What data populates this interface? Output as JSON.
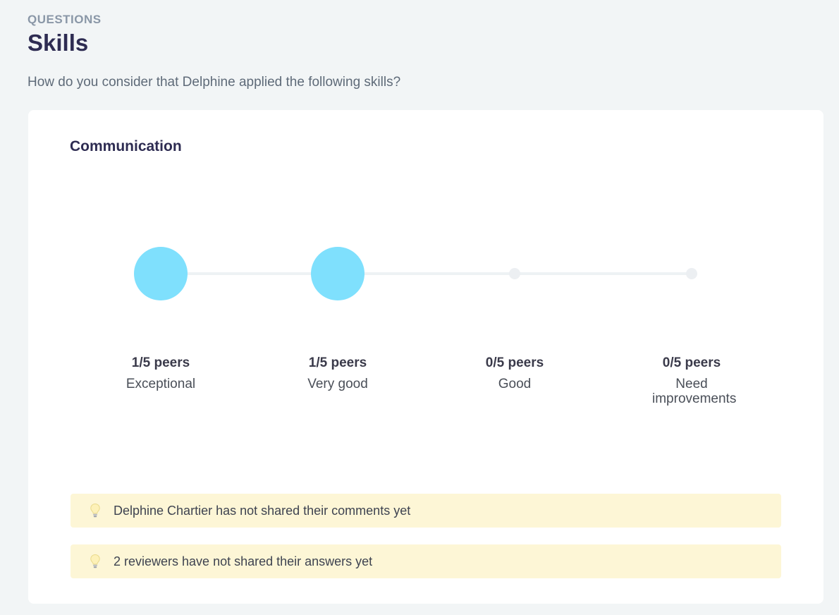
{
  "header": {
    "eyebrow": "QUESTIONS",
    "title": "Skills",
    "question": "How do you consider that Delphine applied the following skills?"
  },
  "skill": {
    "name": "Communication",
    "levels": [
      {
        "count": "1/5 peers",
        "label": "Exceptional",
        "peers": 1,
        "total": 5
      },
      {
        "count": "1/5 peers",
        "label": "Very good",
        "peers": 1,
        "total": 5
      },
      {
        "count": "0/5 peers",
        "label": "Good",
        "peers": 0,
        "total": 5
      },
      {
        "count": "0/5 peers",
        "label": "Need improvements",
        "peers": 0,
        "total": 5
      }
    ]
  },
  "notices": [
    {
      "icon": "lightbulb-icon",
      "text": "Delphine Chartier has not shared their comments yet"
    },
    {
      "icon": "lightbulb-icon",
      "text": "2 reviewers have not shared their answers yet"
    }
  ],
  "colors": {
    "selected": "#7fe0fd",
    "notice_bg": "#fdf6d6"
  }
}
